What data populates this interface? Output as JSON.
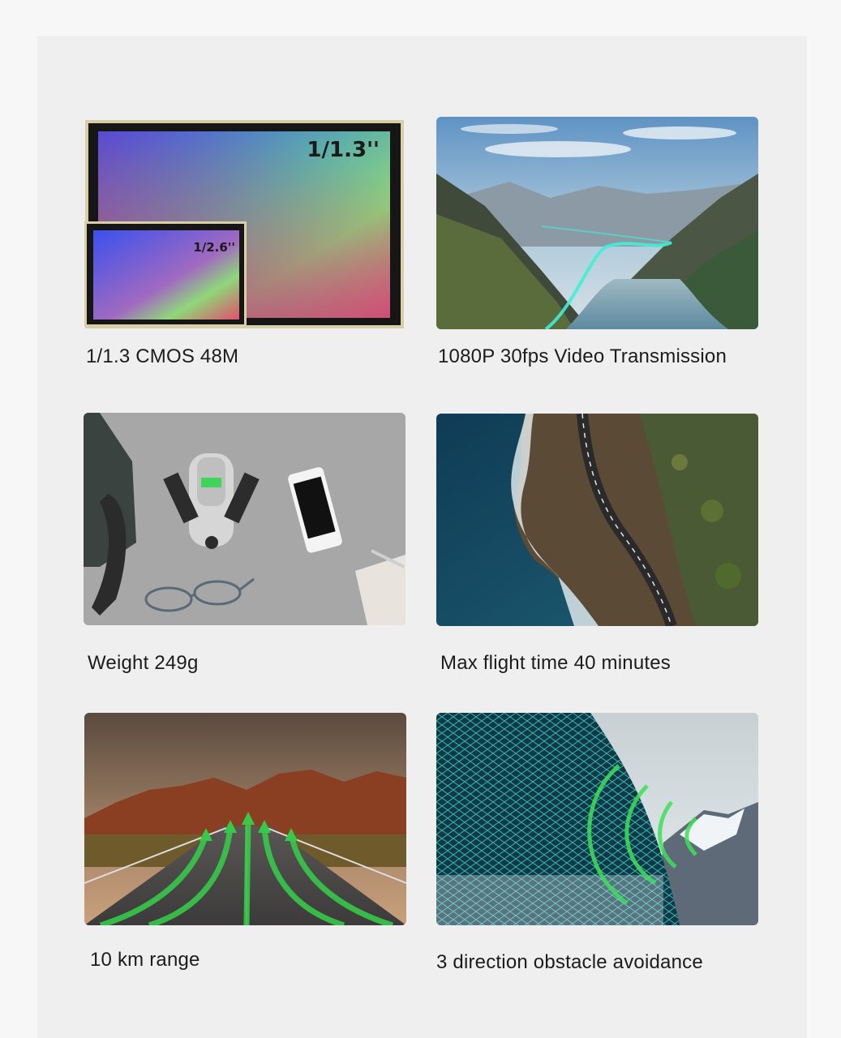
{
  "features": [
    {
      "caption": "1/1.3  CMOS 48M",
      "image": "sensor-size-comparison-image",
      "large_sensor_label": "1/1.3''",
      "small_sensor_label": "1/2.6''"
    },
    {
      "caption": "1080P  30fps Video Transmission",
      "image": "mountain-lake-transmission-image"
    },
    {
      "caption": "Weight 249g",
      "image": "drone-on-desk-image"
    },
    {
      "caption": "Max flight time 40 minutes",
      "image": "coastal-road-aerial-image"
    },
    {
      "caption": "10 km range",
      "image": "desert-road-arrows-image"
    },
    {
      "caption": "3 direction obstacle avoidance",
      "image": "mountain-mesh-scan-image"
    }
  ]
}
